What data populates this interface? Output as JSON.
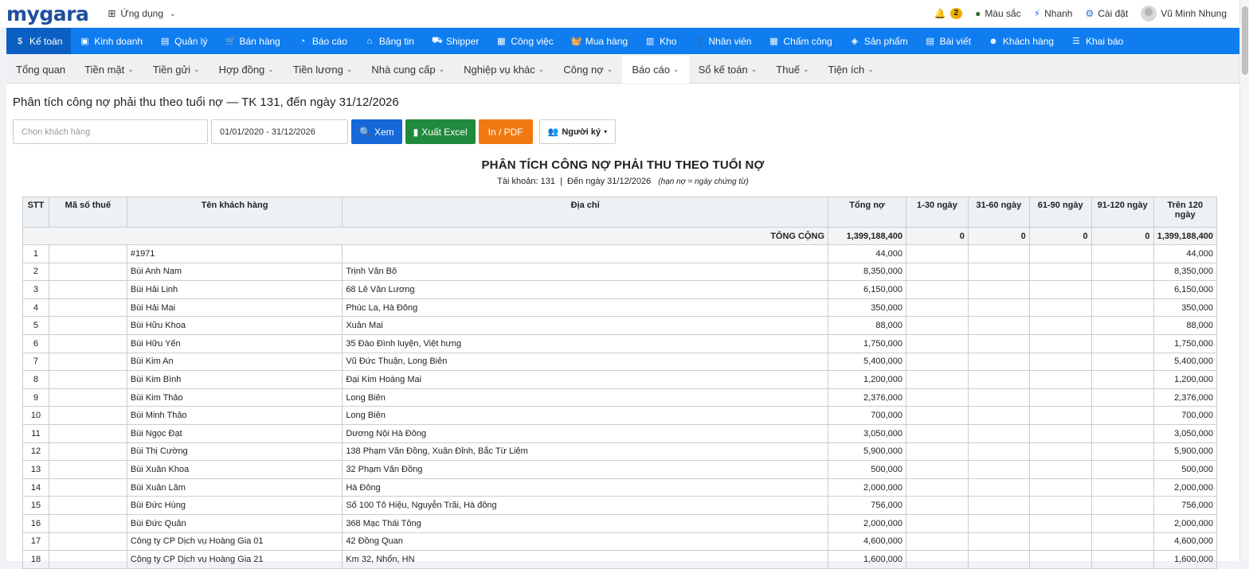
{
  "brand": "mygara",
  "apps_label": "Ứng dụng",
  "top": {
    "notif_count": "2",
    "color_label": "Màu sắc",
    "quick_label": "Nhanh",
    "settings_label": "Cài đặt",
    "user_name": "Vũ Minh Nhung"
  },
  "main_nav": [
    "Kế toán",
    "Kinh doanh",
    "Quản lý",
    "Bán hàng",
    "Báo cáo",
    "Bảng tin",
    "Shipper",
    "Công việc",
    "Mua hàng",
    "Kho",
    "Nhân viên",
    "Chấm công",
    "Sản phẩm",
    "Bài viết",
    "Khách hàng",
    "Khai báo"
  ],
  "main_nav_icons": [
    "$",
    "▣",
    "▤",
    "🛒",
    "◔",
    "⌂",
    "⛟",
    "▦",
    "🧺",
    "▥",
    "👤",
    "▦",
    "◈",
    "▤",
    "☻",
    "☰"
  ],
  "sub_nav": [
    "Tổng quan",
    "Tiền mặt",
    "Tiền gửi",
    "Hợp đồng",
    "Tiền lương",
    "Nhà cung cấp",
    "Nghiệp vụ khác",
    "Công nợ",
    "Báo cáo",
    "Sổ kế toán",
    "Thuế",
    "Tiện ích"
  ],
  "sub_nav_chevron": [
    false,
    true,
    true,
    true,
    true,
    true,
    true,
    true,
    true,
    true,
    true,
    true
  ],
  "page_title": "Phân tích công nợ phải thu theo tuổi nợ — TK 131, đến ngày 31/12/2026",
  "filters": {
    "customer_placeholder": "Chọn khách hàng",
    "date_range": "01/01/2020 - 31/12/2026",
    "view_label": "Xem",
    "excel_label": "Xuất Excel",
    "pdf_label": "In / PDF",
    "signer_label": "Người ký"
  },
  "report": {
    "title": "PHÂN TÍCH CÔNG NỢ PHẢI THU THEO TUỔI NỢ",
    "subtitle": "Tài khoản: 131  |  Đến ngày 31/12/2026",
    "note": "(hạn nợ = ngày chứng từ)"
  },
  "columns": [
    "STT",
    "Mã số thuế",
    "Tên khách hàng",
    "Địa chỉ",
    "Tổng nợ",
    "1-30 ngày",
    "31-60 ngày",
    "61-90 ngày",
    "91-120 ngày",
    "Trên 120 ngày"
  ],
  "total": {
    "label": "TỔNG CỘNG",
    "total": "1,399,188,400",
    "d30": "0",
    "d60": "0",
    "d90": "0",
    "d120": "0",
    "over": "1,399,188,400"
  },
  "rows": [
    {
      "stt": "1",
      "tax": "",
      "name": "#1971",
      "addr": "",
      "total": "44,000",
      "over": "44,000"
    },
    {
      "stt": "2",
      "tax": "",
      "name": "Bùi Anh Nam",
      "addr": "Trịnh Văn Bô",
      "total": "8,350,000",
      "over": "8,350,000"
    },
    {
      "stt": "3",
      "tax": "",
      "name": "Bùi Hải Linh",
      "addr": "68 Lê Văn Lương",
      "total": "6,150,000",
      "over": "6,150,000"
    },
    {
      "stt": "4",
      "tax": "",
      "name": "Bùi Hải Mai",
      "addr": "Phúc La, Hà Đông",
      "total": "350,000",
      "over": "350,000"
    },
    {
      "stt": "5",
      "tax": "",
      "name": "Bùi Hữu Khoa",
      "addr": "Xuân Mai",
      "total": "88,000",
      "over": "88,000"
    },
    {
      "stt": "6",
      "tax": "",
      "name": "Bùi Hữu Yến",
      "addr": "35 Đào Đình luyện, Việt hưng",
      "total": "1,750,000",
      "over": "1,750,000"
    },
    {
      "stt": "7",
      "tax": "",
      "name": "Bùi Kim An",
      "addr": "Vũ Đức Thuận, Long Biên",
      "total": "5,400,000",
      "over": "5,400,000"
    },
    {
      "stt": "8",
      "tax": "",
      "name": "Bùi Kim Bình",
      "addr": "Đại Kim Hoàng Mai",
      "total": "1,200,000",
      "over": "1,200,000"
    },
    {
      "stt": "9",
      "tax": "",
      "name": "Bùi Kim Thảo",
      "addr": "Long Biên",
      "total": "2,376,000",
      "over": "2,376,000"
    },
    {
      "stt": "10",
      "tax": "",
      "name": "Bùi Minh Thảo",
      "addr": "Long Biên",
      "total": "700,000",
      "over": "700,000"
    },
    {
      "stt": "11",
      "tax": "",
      "name": "Bùi Ngọc Đạt",
      "addr": "Dương Nội Hà Đông",
      "total": "3,050,000",
      "over": "3,050,000"
    },
    {
      "stt": "12",
      "tax": "",
      "name": "Bùi Thị Cường",
      "addr": "138 Phạm Văn Đồng, Xuân Đỉnh, Bắc Từ Liêm",
      "total": "5,900,000",
      "over": "5,900,000"
    },
    {
      "stt": "13",
      "tax": "",
      "name": "Bùi Xuân Khoa",
      "addr": "32 Phạm Văn Đồng",
      "total": "500,000",
      "over": "500,000"
    },
    {
      "stt": "14",
      "tax": "",
      "name": "Bùi Xuân Lâm",
      "addr": "Hà Đông",
      "total": "2,000,000",
      "over": "2,000,000"
    },
    {
      "stt": "15",
      "tax": "",
      "name": "Bùi Đức Hùng",
      "addr": "Số 100 Tô Hiệu, Nguyễn Trãi, Hà đông",
      "total": "756,000",
      "over": "756,000"
    },
    {
      "stt": "16",
      "tax": "",
      "name": "Bùi Đức Quân",
      "addr": "368 Mạc Thái Tông",
      "total": "2,000,000",
      "over": "2,000,000"
    },
    {
      "stt": "17",
      "tax": "",
      "name": "Công ty CP Dịch vụ Hoàng Gia 01",
      "addr": "42 Đồng Quan",
      "total": "4,600,000",
      "over": "4,600,000"
    },
    {
      "stt": "18",
      "tax": "",
      "name": "Công ty CP Dịch vụ Hoàng Gia 21",
      "addr": "Km 32, Nhổn, HN",
      "total": "1,600,000",
      "over": "1,600,000"
    }
  ],
  "colors": {
    "nav_blue": "#0f7df0",
    "nav_active": "#0b5fc2",
    "btn_view": "#1667d8",
    "btn_excel": "#208a3c",
    "btn_pdf": "#f07a10",
    "brand": "#1d4e9e"
  }
}
